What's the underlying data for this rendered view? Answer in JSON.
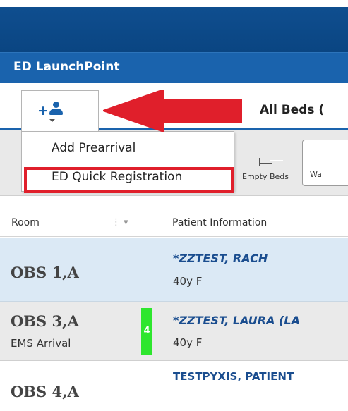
{
  "app": {
    "title": "ED LaunchPoint"
  },
  "tabs": {
    "partial_label": "(",
    "all_beds_label": "All Beds ("
  },
  "toolbar": {
    "empty_beds_label": "Empty Beds",
    "wa_label": "Wa"
  },
  "add_menu": {
    "items": [
      {
        "label": "Add Prearrival"
      },
      {
        "label": "ED Quick Registration"
      }
    ]
  },
  "grid": {
    "columns": {
      "room": "Room",
      "patient_information": "Patient Information"
    },
    "rows": [
      {
        "room": "OBS 1,A",
        "room_sub": "",
        "acuity": "",
        "patient_name": "*ZZTEST, RACH",
        "patient_info": "40y F"
      },
      {
        "room": "OBS 3,A",
        "room_sub": "EMS Arrival",
        "acuity": "4",
        "patient_name": "*ZZTEST, LAURA (LA",
        "patient_info": "40y F"
      },
      {
        "room": "OBS 4,A",
        "room_sub": "",
        "acuity": "",
        "patient_name": "TESTPYXIS, PATIENT",
        "patient_info": ""
      }
    ]
  },
  "colors": {
    "brand_blue": "#1a63ad",
    "highlight_red": "#e01f2b",
    "acuity_green": "#2ee62e",
    "selected_row": "#dbe9f5"
  },
  "icons": {
    "add_patient": "add-person-icon",
    "empty_beds": "bed-icon",
    "annotation": "red-arrow"
  }
}
